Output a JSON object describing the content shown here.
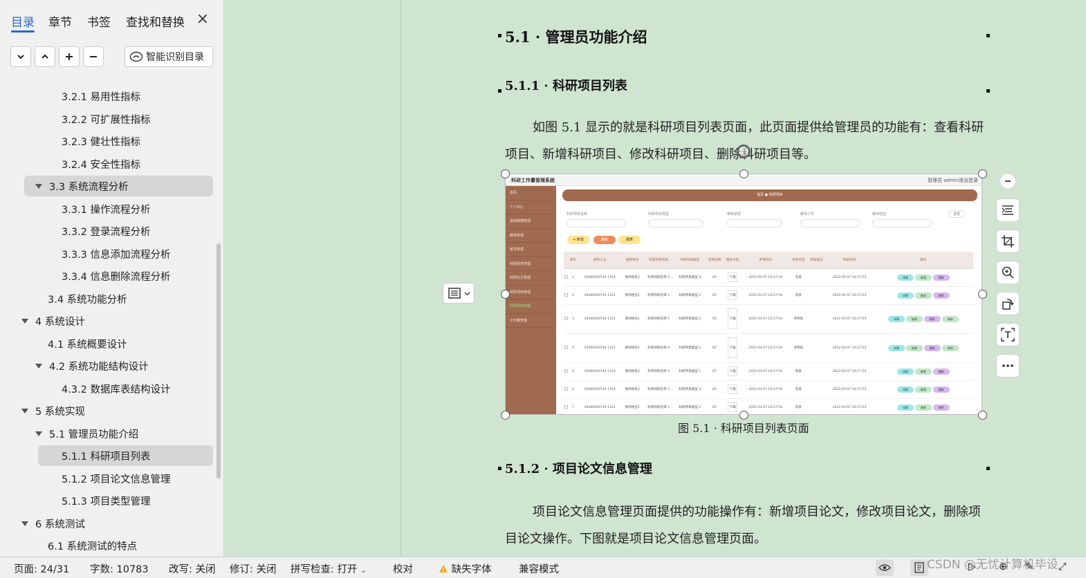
{
  "sidebar": {
    "tabs": [
      "目录",
      "章节",
      "书签",
      "查找和替换"
    ],
    "smart_label": "智能识别目录",
    "toc": [
      "3.2.1  易用性指标",
      "3.2.2  可扩展性指标",
      "3.2.3  健壮性指标",
      "3.2.4  安全性指标",
      "3.3  系统流程分析",
      "3.3.1  操作流程分析",
      "3.3.2  登录流程分析",
      "3.3.3  信息添加流程分析",
      "3.3.4  信息删除流程分析",
      "3.4  系统功能分析",
      "4  系统设计",
      "4.1  系统概要设计",
      "4.2  系统功能结构设计",
      "4.3.2  数据库表结构设计",
      "5  系统实现",
      "5.1  管理员功能介绍",
      "5.1.1  科研项目列表",
      "5.1.2  项目论文信息管理",
      "5.1.3 项目类型管理",
      "6  系统测试",
      "6.1  系统测试的特点"
    ]
  },
  "doc": {
    "h1": "5.1 · 管理员功能介绍",
    "h2a": "5.1.1 · 科研项目列表",
    "para1": "如图 5.1 显示的就是科研项目列表页面，此页面提供给管理员的功能有：查看科研项目、新增科研项目、修改科研项目、删除科研项目等。",
    "caption": "图 5.1 · 科研项目列表页面",
    "h2b": "5.1.2 · 项目论文信息管理",
    "para2": "项目论文信息管理页面提供的功能操作有：新增项目论文，修改项目论文，删除项目论文操作。下图就是项目论文信息管理页面。"
  },
  "shot": {
    "app_title": "科研工作量管理系统",
    "user": "管理员 admin",
    "logout": "退出登录",
    "menu": [
      "首页",
      "个人中心",
      "基础数据管理",
      "教师管理",
      "秘书管理",
      "科研获奖管理",
      "科研论文管理",
      "科研项目管理",
      "科研项目管理",
      "工作量管理"
    ],
    "crumb": "首页 ● 科研项目",
    "filters": [
      "科研项目名称",
      "科研项目类型",
      "审核状态",
      "教师工号",
      "教师姓名"
    ],
    "buttons": [
      "+ 新增",
      "删除",
      "报表"
    ],
    "reset": "重置",
    "columns": [
      "",
      "索引",
      "教师工号",
      "教师姓名",
      "科研项目名称",
      "科研项目类型",
      "项目经费",
      "相关文档",
      "申请时间",
      "审核状态",
      "审核意见",
      "审核时间",
      "操作"
    ],
    "rows": [
      [
        "1",
        "16466200744 1314",
        "教师姓名2",
        "科研项目名称 2",
        "科研项目类型 4",
        "65",
        "下载",
        "2022-02-07 10:27:54",
        "同意",
        "",
        "2022-02-07 10:27:54"
      ],
      [
        "2",
        "16466200744 1311",
        "教师姓名1",
        "科研项目名称 1",
        "科研项目类型 1",
        "87",
        "下载",
        "2022-02-07 10:27:54",
        "同意",
        "",
        "2022-02-07 10:27:54"
      ],
      [
        "3",
        "16466200744 1311",
        "教师姓名1",
        "科研项目名称 5",
        "科研项目类型 4",
        "65",
        "下载",
        "2022-03-07 10:27:54",
        "待审核",
        "",
        "2022-03-07 10:27:54"
      ],
      [
        "4",
        "16466200744 1311",
        "教师姓名1",
        "科研项目名称 4",
        "科研项目类型 1",
        "87",
        "下载",
        "2022-03-07 10:27:54",
        "待审核",
        "",
        "2022-03-07 10:27:54"
      ],
      [
        "5",
        "16466200744 1314",
        "教师姓名2",
        "科研项目名称 3",
        "科研项目类型 1",
        "87",
        "下载",
        "2022-03-07 10:27:54",
        "同意",
        "",
        "2022-03-07 10:27:54"
      ],
      [
        "6",
        "16466200744 1314",
        "教师姓名2",
        "科研项目名称 2",
        "科研项目类型 4",
        "65",
        "下载",
        "2022-03-07 10:27:54",
        "同意",
        "",
        "2022-03-07 10:27:54"
      ],
      [
        "7",
        "16466200744 1311",
        "教师姓名1",
        "科研项目名称 1",
        "科研项目类型 1",
        "87",
        "下载",
        "2022-03-07 10:27:54",
        "同意",
        "",
        "2022-03-07 10:27:54"
      ]
    ],
    "ops": [
      "详情",
      "修改",
      "删除",
      "审核"
    ]
  },
  "status": {
    "page": "页面: 24/31",
    "words": "字数: 10783",
    "rewrite": "改写: 关闭",
    "revise": "修订: 关闭",
    "spell": "拼写检查: 打开",
    "proof": "校对",
    "missing_font": "缺失字体",
    "compat": "兼容模式"
  },
  "watermark": "CSDN @无忧计算机毕设",
  "colors": {
    "accent": "#2a64d6",
    "page_bg": "#cfe5d0",
    "app_brown": "#a06a4f"
  }
}
